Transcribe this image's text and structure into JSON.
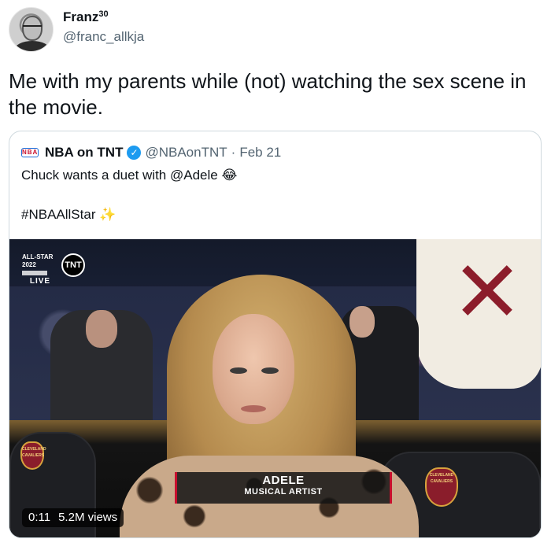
{
  "tweet": {
    "author_name": "Franz",
    "author_name_sup": "30",
    "author_handle": "@franc_allkja",
    "text": "Me with my parents while (not) watching the sex scene in the movie."
  },
  "quoted_tweet": {
    "logo_text": "NBA",
    "author_name": "NBA on TNT",
    "author_handle": "@NBAonTNT",
    "separator": "·",
    "date": "Feb 21",
    "text": "Chuck wants a duet with @Adele",
    "text_emoji": "😂",
    "hashtag": "#NBAAllStar",
    "hashtag_emoji": "✨"
  },
  "video": {
    "bug_event": "ALL-STAR 2022",
    "bug_network": "TNT",
    "bug_live": "LIVE",
    "caption_name": "ADELE",
    "caption_role": "MUSICAL ARTIST",
    "duration": "0:11",
    "views": "5.2M views",
    "seat_logo_text": "CLEVELAND CAVALIERS"
  },
  "colors": {
    "verified": "#1d9bf0",
    "secondary_text": "#536471",
    "border": "#cfd9de",
    "caption_accent": "#c8102e"
  },
  "icons": [
    "avatar-photo",
    "verified-badge-icon",
    "crying-laughing-emoji",
    "sparkle-star-emoji",
    "tnt-logo"
  ]
}
